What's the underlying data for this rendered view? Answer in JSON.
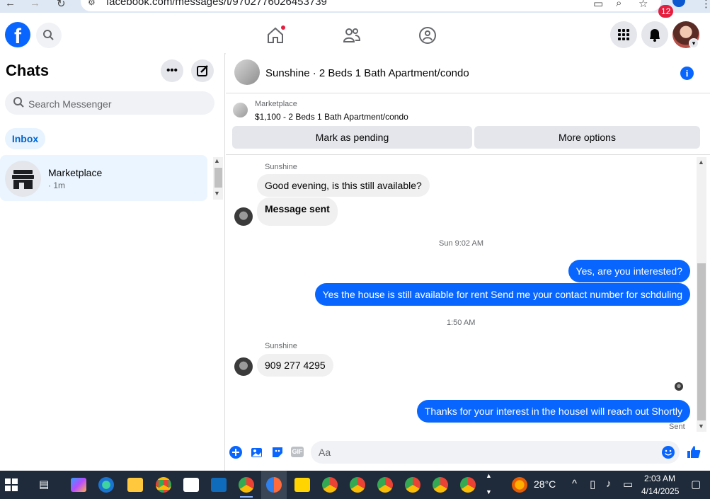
{
  "browser": {
    "url": "facebook.com/messages/t/9702776026453739"
  },
  "header": {
    "notifications_count": "12"
  },
  "sidebar": {
    "title": "Chats",
    "search_placeholder": "Search Messenger",
    "inbox_label": "Inbox",
    "conversations": [
      {
        "name": "Marketplace",
        "time": "· 1m"
      }
    ]
  },
  "chat": {
    "title": "Sunshine · 2 Beds 1 Bath Apartment/condo",
    "listing_source": "Marketplace",
    "listing_text": "$1,100 - 2 Beds 1 Bath Apartment/condo",
    "mark_pending_label": "Mark as pending",
    "more_options_label": "More options",
    "messages": [
      {
        "sender": "Sunshine",
        "text": "Good evening, is this still available?"
      },
      {
        "text": "Message sent"
      },
      {
        "timestamp": "Sun 9:02 AM"
      },
      {
        "text": "Yes, are you interested?"
      },
      {
        "text": "Yes the house is still available for rent Send me your contact number for schduling"
      },
      {
        "timestamp": "1:50 AM"
      },
      {
        "sender": "Sunshine",
        "text": "909 277 4295"
      },
      {
        "text": "Thanks for your interest in the houseI will reach out Shortly"
      }
    ],
    "status": "Sent",
    "composer_placeholder": "Aa"
  },
  "taskbar": {
    "temperature": "28°C",
    "time": "2:03 AM",
    "date": "4/14/2025"
  },
  "colors": {
    "brand": "#0866ff",
    "bubble_in": "#f0f0f0",
    "taskbar": "#1f2b3a"
  }
}
